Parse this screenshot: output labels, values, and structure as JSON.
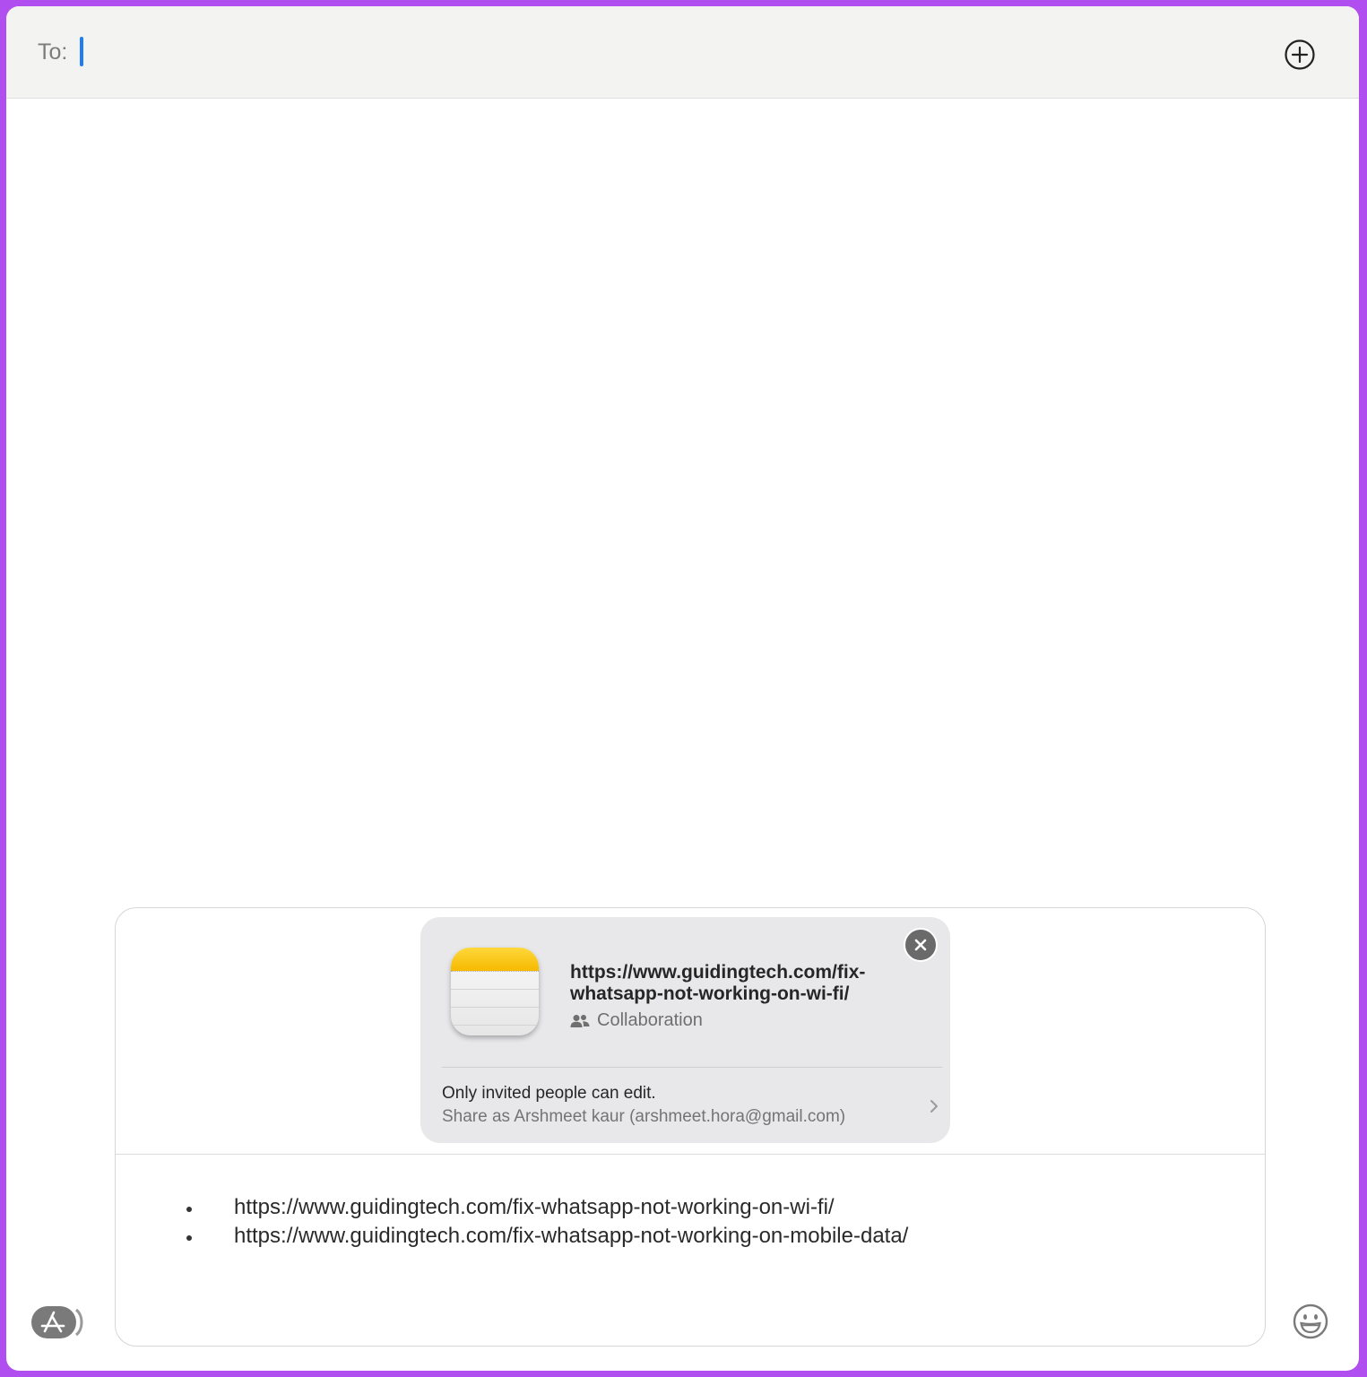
{
  "header": {
    "to_label": "To:"
  },
  "attachment": {
    "title": "https://www.guidingtech.com/fix-whatsapp-not-working-on-wi-fi/",
    "subtitle": "Collaboration",
    "permission": "Only invited people can edit.",
    "share_as": "Share as Arshmeet kaur (arshmeet.hora@gmail.com)",
    "icon": "notes-app-icon"
  },
  "message": {
    "items": [
      "https://www.guidingtech.com/fix-whatsapp-not-working-on-wi-fi/",
      "https://www.guidingtech.com/fix-whatsapp-not-working-on-mobile-data/"
    ]
  },
  "icons": {
    "add": "plus-circle-icon",
    "close": "close-icon",
    "collaboration": "people-icon",
    "chevron": "chevron-right-icon",
    "apps": "app-store-icon",
    "emoji": "emoji-icon"
  },
  "colors": {
    "frame": "#b04ef0",
    "caret": "#1f7cf4",
    "notes_yellow": "#f5b900"
  }
}
